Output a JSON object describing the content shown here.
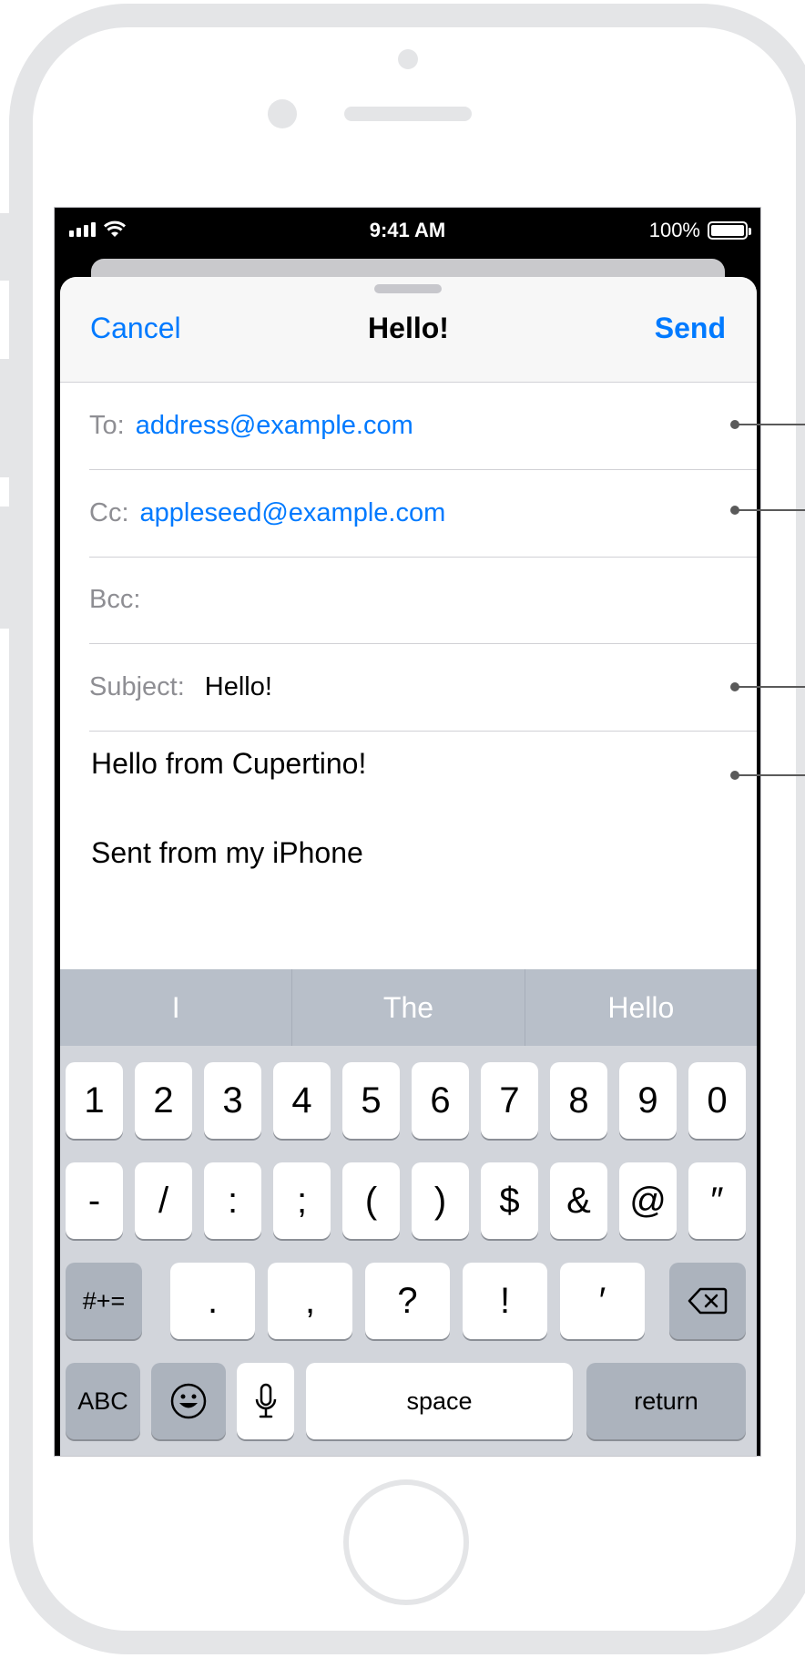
{
  "status_bar": {
    "time": "9:41 AM",
    "battery": "100%"
  },
  "nav": {
    "cancel": "Cancel",
    "title": "Hello!",
    "send": "Send"
  },
  "fields": {
    "to_label": "To:",
    "to_value": "address@example.com",
    "cc_label": "Cc:",
    "cc_value": "appleseed@example.com",
    "bcc_label": "Bcc:",
    "subject_label": "Subject:",
    "subject_value": "Hello!"
  },
  "body": {
    "line1": "Hello from Cupertino!",
    "line2": "Sent from my iPhone"
  },
  "predictive": [
    "I",
    "The",
    "Hello"
  ],
  "keyboard": {
    "row1": [
      "1",
      "2",
      "3",
      "4",
      "5",
      "6",
      "7",
      "8",
      "9",
      "0"
    ],
    "row2": [
      "-",
      "/",
      ":",
      ";",
      "(",
      ")",
      "$",
      "&",
      "@",
      "″"
    ],
    "row3": [
      ".",
      ",",
      "?",
      "!",
      "′"
    ],
    "mode_symbols": "#+=",
    "mode_abc": "ABC",
    "space": "space",
    "return": "return"
  },
  "icons": {
    "wifi": "wifi-icon",
    "signal": "signal-icon",
    "battery": "battery-icon",
    "backspace": "backspace-icon",
    "emoji": "emoji-icon",
    "microphone": "microphone-icon"
  },
  "colors": {
    "accent": "#007aff",
    "label_gray": "#8e8e93",
    "keyboard_bg": "#d2d5db",
    "predict_bg": "#b8bfc9"
  }
}
